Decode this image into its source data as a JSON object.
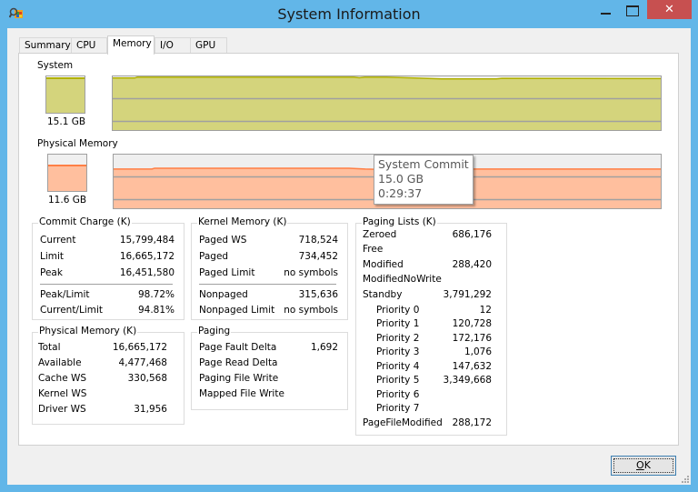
{
  "window": {
    "title": "System Information",
    "close_label": "✕"
  },
  "tabs": [
    {
      "label": "Summary",
      "active": false
    },
    {
      "label": "CPU",
      "active": false
    },
    {
      "label": "Memory",
      "active": true
    },
    {
      "label": "I/O",
      "active": false
    },
    {
      "label": "GPU",
      "active": false
    }
  ],
  "graphs": {
    "system": {
      "label": "System",
      "value_label": "15.1 GB",
      "fill_fraction": 0.97,
      "color_fill": "#d4d47c",
      "color_line": "#b0b000"
    },
    "physical": {
      "label": "Physical Memory",
      "value_label": "11.6 GB",
      "fill_fraction": 0.73,
      "color_fill": "#ffbf9e",
      "color_line": "#ff7f45"
    }
  },
  "tooltip": {
    "title": "System Commit",
    "value": "15.0 GB",
    "time": "0:29:37"
  },
  "commit_charge": {
    "title": "Commit Charge (K)",
    "rows": [
      {
        "key": "Current",
        "value": "15,799,484"
      },
      {
        "key": "Limit",
        "value": "16,665,172"
      },
      {
        "key": "Peak",
        "value": "16,451,580"
      },
      {
        "key": "Peak/Limit",
        "value": "98.72%"
      },
      {
        "key": "Current/Limit",
        "value": "94.81%"
      }
    ]
  },
  "physical_memory": {
    "title": "Physical Memory (K)",
    "rows": [
      {
        "key": "Total",
        "value": "16,665,172"
      },
      {
        "key": "Available",
        "value": "4,477,468"
      },
      {
        "key": "Cache WS",
        "value": "330,568"
      },
      {
        "key": "Kernel WS",
        "value": ""
      },
      {
        "key": "Driver WS",
        "value": "31,956"
      }
    ]
  },
  "kernel_memory": {
    "title": "Kernel Memory (K)",
    "rows": [
      {
        "key": "Paged WS",
        "value": "718,524"
      },
      {
        "key": "Paged",
        "value": "734,452"
      },
      {
        "key": "Paged Limit",
        "value": "no symbols"
      },
      {
        "key": "Nonpaged",
        "value": "315,636"
      },
      {
        "key": "Nonpaged Limit",
        "value": "no symbols"
      }
    ]
  },
  "paging": {
    "title": "Paging",
    "rows": [
      {
        "key": "Page Fault Delta",
        "value": "1,692"
      },
      {
        "key": "Page Read Delta",
        "value": ""
      },
      {
        "key": "Paging File Write",
        "value": ""
      },
      {
        "key": "Mapped File Write",
        "value": ""
      }
    ]
  },
  "paging_lists": {
    "title": "Paging Lists (K)",
    "rows": [
      {
        "key": "Zeroed",
        "value": "686,176"
      },
      {
        "key": "Free",
        "value": ""
      },
      {
        "key": "Modified",
        "value": "288,420"
      },
      {
        "key": "ModifiedNoWrite",
        "value": ""
      },
      {
        "key": "Standby",
        "value": "3,791,292"
      },
      {
        "key": "Priority 0",
        "value": "12"
      },
      {
        "key": "Priority 1",
        "value": "120,728"
      },
      {
        "key": "Priority 2",
        "value": "172,176"
      },
      {
        "key": "Priority 3",
        "value": "1,076"
      },
      {
        "key": "Priority 4",
        "value": "147,632"
      },
      {
        "key": "Priority 5",
        "value": "3,349,668"
      },
      {
        "key": "Priority 6",
        "value": ""
      },
      {
        "key": "Priority 7",
        "value": ""
      },
      {
        "key": "PageFileModified",
        "value": "288,172"
      }
    ]
  },
  "buttons": {
    "ok_prefix": "O",
    "ok_rest": "K"
  }
}
